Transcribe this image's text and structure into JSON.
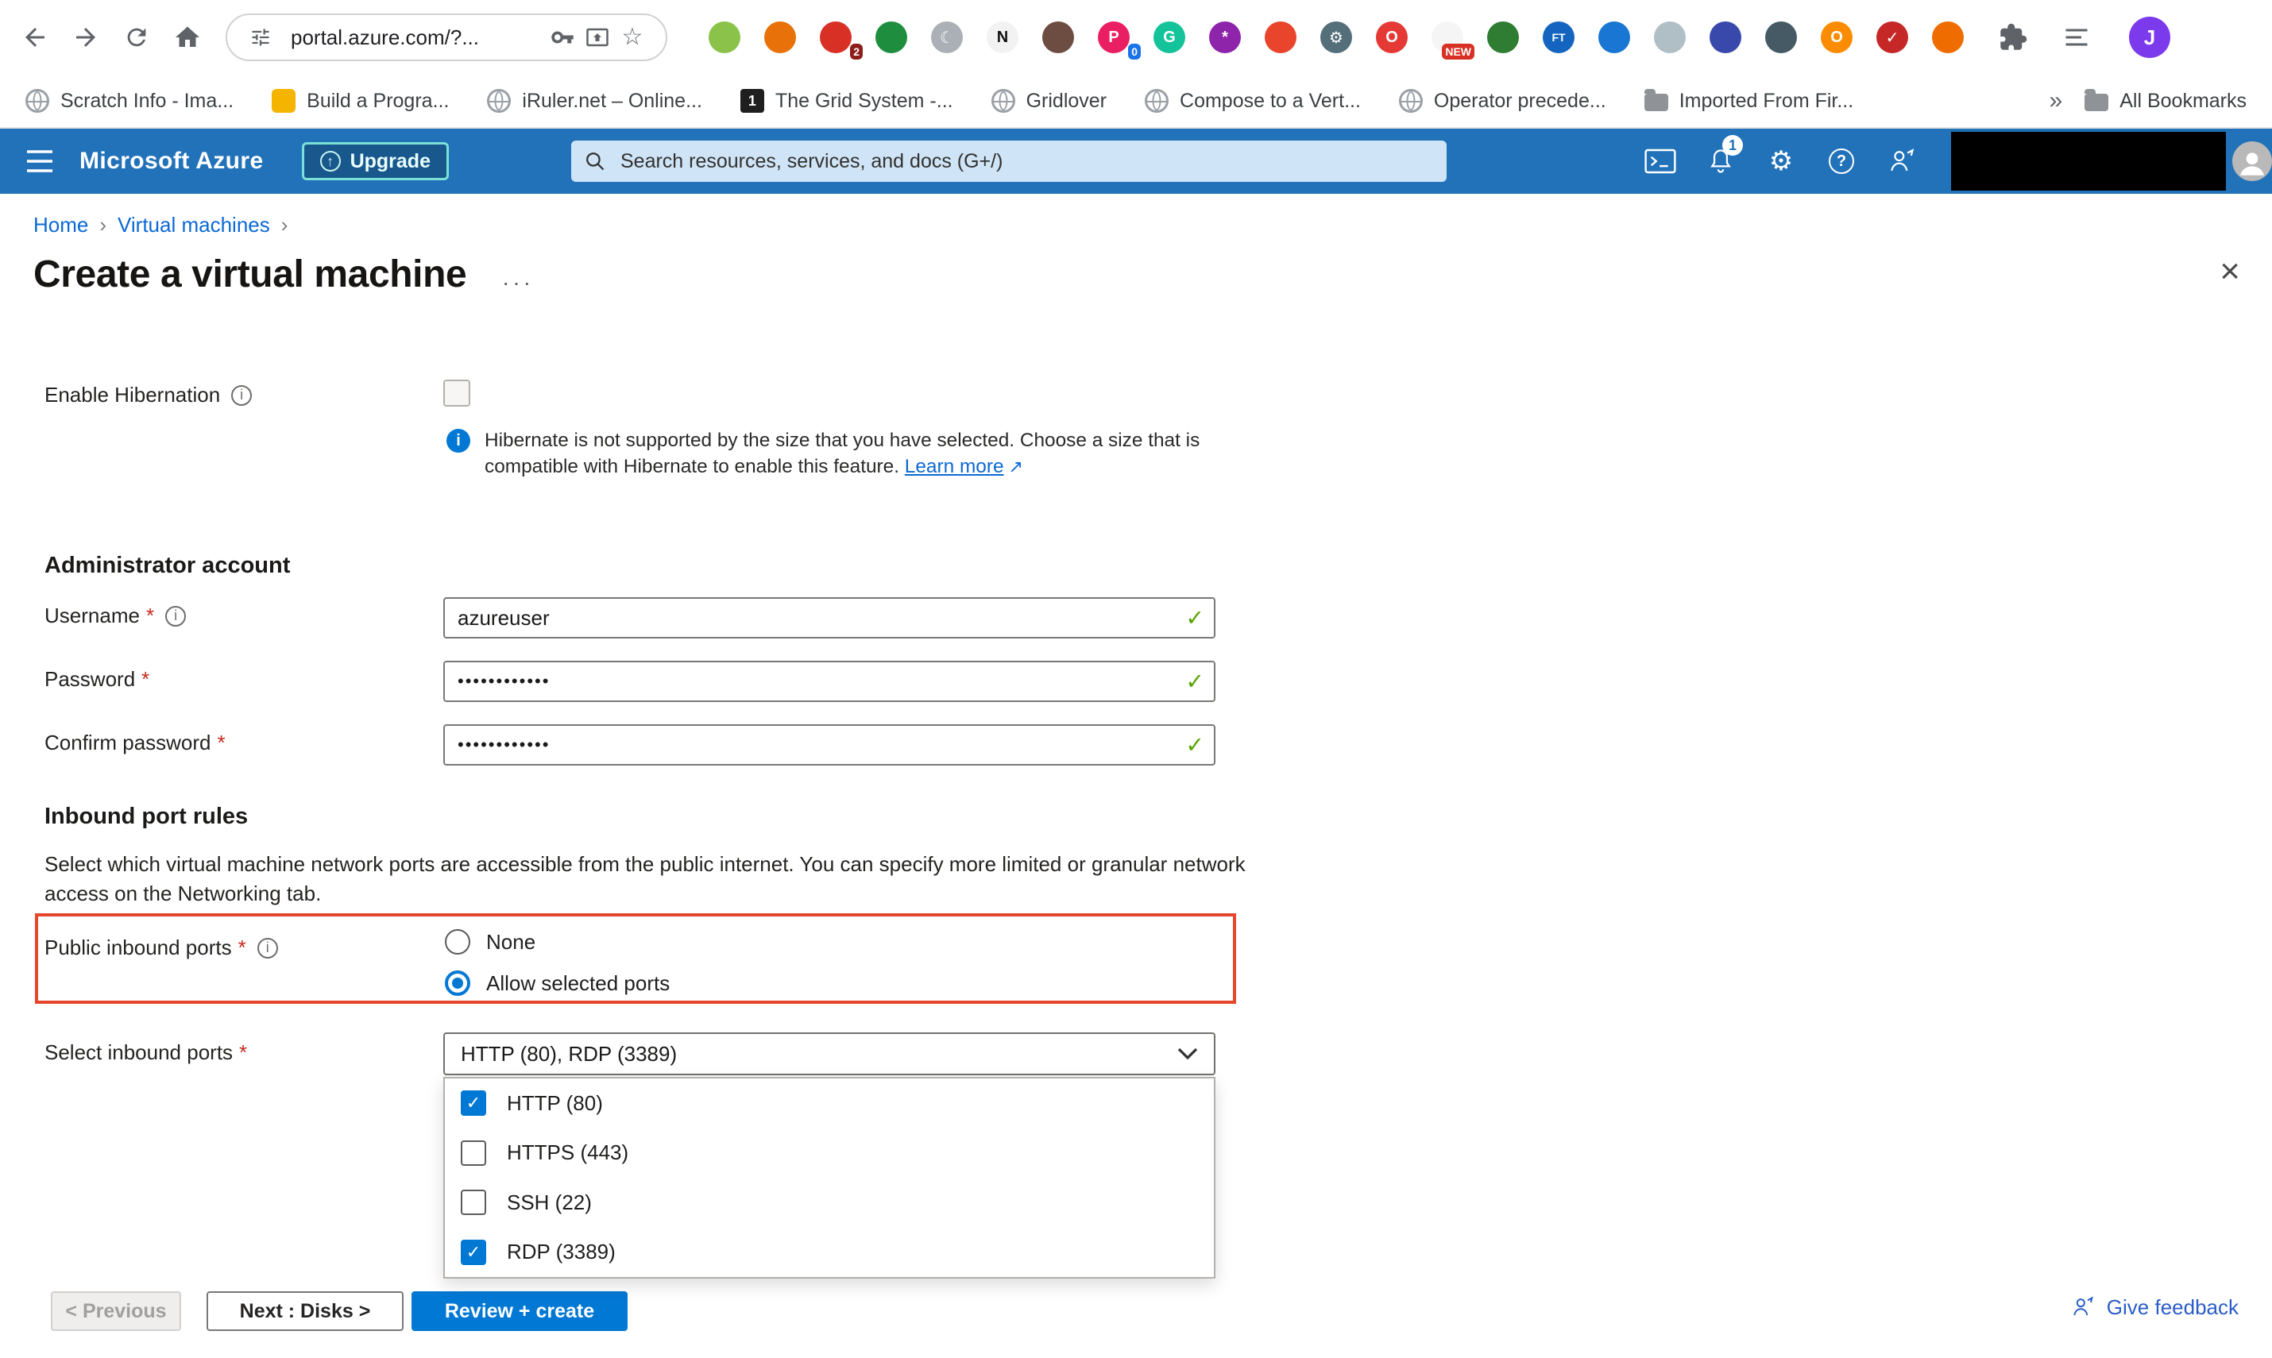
{
  "colors": {
    "header-blue": "#2272b9",
    "accent-blue": "#0078d4",
    "link-blue": "#0b69d4",
    "success-green": "#57a300",
    "error-red": "#c42b1c",
    "focus-red": "#e5472d",
    "upgrade-teal": "#7be0d6",
    "avatar-purple": "#7c3aed",
    "feedback-blue": "#2b5dc8"
  },
  "browser": {
    "url": "portal.azure.com/?...",
    "profile_initial": "J",
    "overflow_glyph": "»",
    "extensions": [
      {
        "name": "ext-green",
        "color": "#8bc34a"
      },
      {
        "name": "ext-orange-box",
        "color": "#e8710a"
      },
      {
        "name": "ext-red",
        "color": "#d93025",
        "badge": "2",
        "badge_bg": "#8c1d18"
      },
      {
        "name": "ext-sheets",
        "color": "#1e8e3e"
      },
      {
        "name": "ext-moon",
        "color": "#aab0b6",
        "glyph": "☾"
      },
      {
        "name": "ext-notion",
        "color": "#f2f2f2",
        "fg": "#111111",
        "glyph": "N"
      },
      {
        "name": "ext-brown",
        "color": "#6d4c41"
      },
      {
        "name": "ext-pink-p",
        "color": "#e91e63",
        "glyph": "P",
        "badge": "0",
        "badge_bg": "#1a73e8"
      },
      {
        "name": "ext-grammarly",
        "color": "#15c39a",
        "glyph": "G"
      },
      {
        "name": "ext-purple",
        "color": "#8e24aa",
        "glyph": "*"
      },
      {
        "name": "ext-vermilion",
        "color": "#e8452c"
      },
      {
        "name": "ext-gear",
        "color": "#546e7a",
        "glyph": "⚙"
      },
      {
        "name": "ext-red-o",
        "color": "#e53935",
        "glyph": "O"
      },
      {
        "name": "ext-new",
        "color": "#f5f5f5",
        "fg": "#c62828",
        "badge": "NEW",
        "badge_bg": "#d93025"
      },
      {
        "name": "ext-tree",
        "color": "#2e7d32"
      },
      {
        "name": "ext-ft",
        "color": "#1565c0",
        "glyph": "FT"
      },
      {
        "name": "ext-case",
        "color": "#1976d2"
      },
      {
        "name": "ext-file",
        "color": "#b0bec5"
      },
      {
        "name": "ext-grid",
        "color": "#3949ab"
      },
      {
        "name": "ext-slate",
        "color": "#455a64"
      },
      {
        "name": "ext-orange-o",
        "color": "#fb8c00",
        "glyph": "O"
      },
      {
        "name": "ext-check",
        "color": "#c62828",
        "glyph": "✓"
      },
      {
        "name": "ext-amber",
        "color": "#ef6c00"
      }
    ],
    "bookmarks": [
      {
        "label": "Scratch Info - Ima...",
        "icon": "globe"
      },
      {
        "label": "Build a Progra...",
        "icon": "art",
        "color": "#f4b400"
      },
      {
        "label": "iRuler.net – Online...",
        "icon": "globe"
      },
      {
        "label": "The Grid System -...",
        "icon": "badge",
        "badge": "1"
      },
      {
        "label": "Gridlover",
        "icon": "globe"
      },
      {
        "label": "Compose to a Vert...",
        "icon": "globe"
      },
      {
        "label": "Operator precede...",
        "icon": "globe"
      },
      {
        "label": "Imported From Fir...",
        "icon": "folder"
      }
    ],
    "all_bookmarks_label": "All Bookmarks"
  },
  "azure_header": {
    "brand": "Microsoft Azure",
    "upgrade_label": "Upgrade",
    "search_placeholder": "Search resources, services, and docs (G+/)",
    "notification_count": "1"
  },
  "breadcrumb": {
    "items": [
      {
        "label": "Home"
      },
      {
        "label": "Virtual machines"
      }
    ]
  },
  "page": {
    "title": "Create a virtual machine"
  },
  "form": {
    "hibernation_label": "Enable Hibernation",
    "hibernate_info_text": "Hibernate is not supported by the size that you have selected. Choose a size that is compatible with Hibernate to enable this feature.",
    "hibernate_info_link": "Learn more",
    "admin_section_title": "Administrator account",
    "username_label": "Username",
    "username_value": "azureuser",
    "password_label": "Password",
    "password_value": "••••••••••••",
    "confirm_label": "Confirm password",
    "confirm_value": "••••••••••••",
    "inbound_section_title": "Inbound port rules",
    "inbound_description": "Select which virtual machine network ports are accessible from the public internet. You can specify more limited or granular network access on the Networking tab.",
    "public_inbound_label": "Public inbound ports",
    "public_inbound_options": [
      {
        "label": "None",
        "selected": false
      },
      {
        "label": "Allow selected ports",
        "selected": true
      }
    ],
    "select_ports_label": "Select inbound ports",
    "select_ports_value": "HTTP (80), RDP (3389)",
    "port_options": [
      {
        "label": "HTTP (80)",
        "checked": true
      },
      {
        "label": "HTTPS (443)",
        "checked": false
      },
      {
        "label": "SSH (22)",
        "checked": false
      },
      {
        "label": "RDP (3389)",
        "checked": true
      }
    ]
  },
  "footer": {
    "previous_label": "< Previous",
    "next_label": "Next : Disks >",
    "review_label": "Review + create",
    "feedback_label": "Give feedback"
  }
}
